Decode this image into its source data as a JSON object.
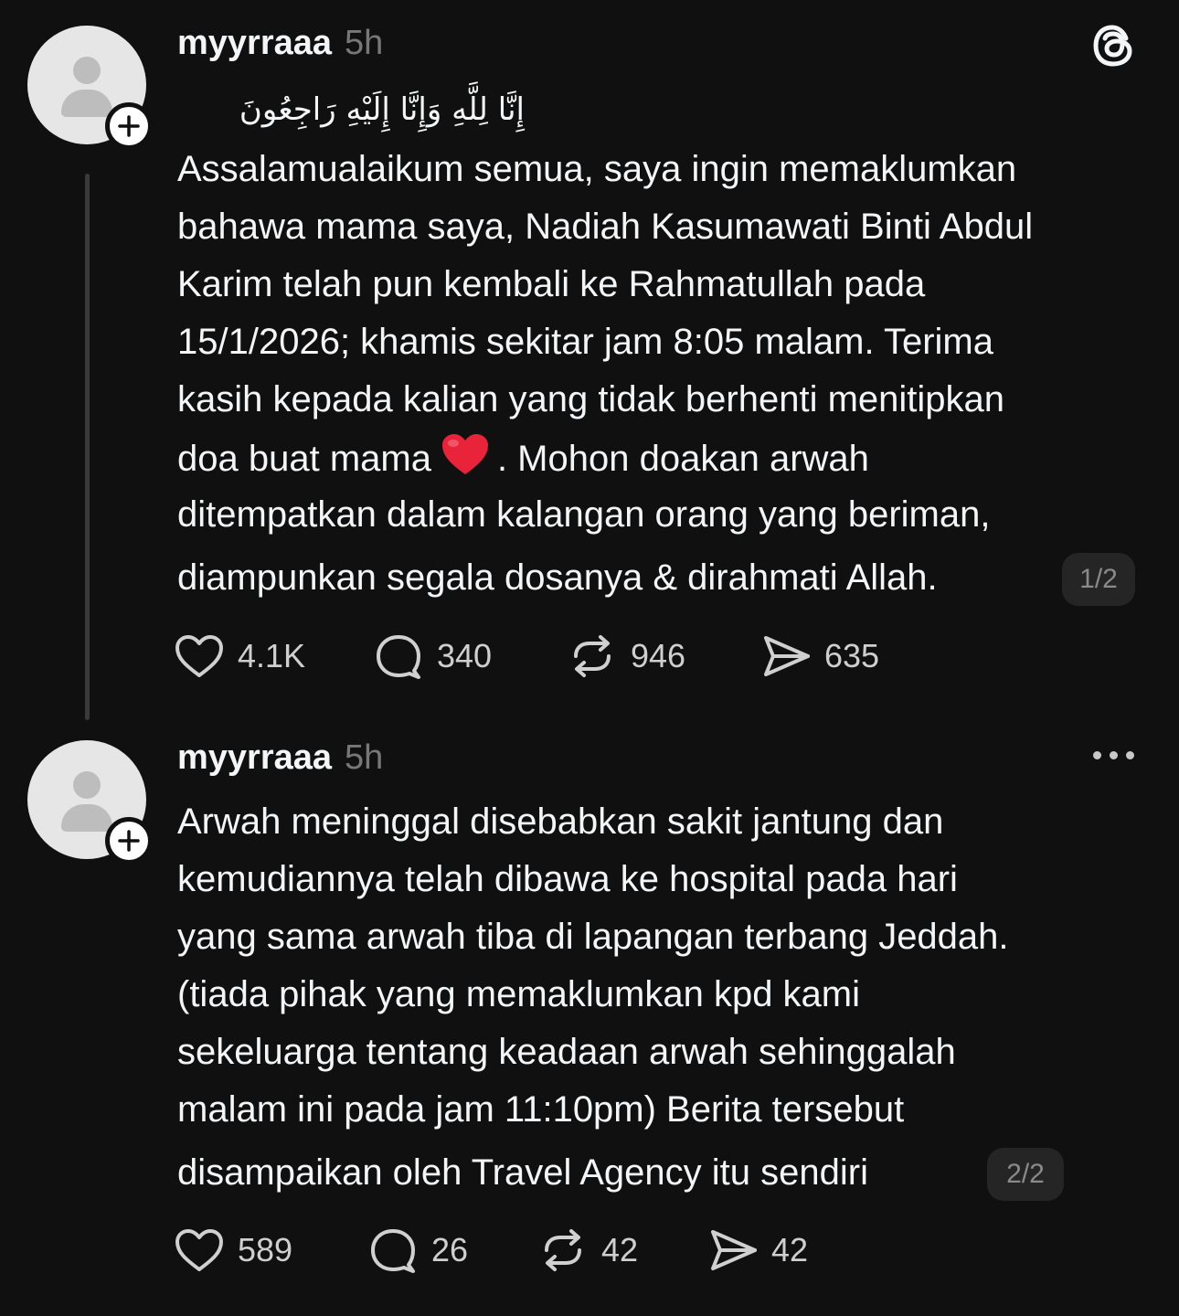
{
  "posts": [
    {
      "username": "myyrraaa",
      "time": "5h",
      "arabic_line": "إِنَّا لِلَّهِ وَإِنَّا إِلَيْهِ رَاجِعُونَ",
      "lines": [
        "Assalamualaikum semua, saya ingin memaklumkan",
        "bahawa mama saya, Nadiah Kasumawati Binti Abdul",
        "Karim telah pun kembali ke Rahmatullah pada",
        "15/1/2026; khamis sekitar jam 8:05 malam. Terima",
        "kasih kepada kalian yang tidak berhenti menitipkan"
      ],
      "line6_before_emoji": "doa buat mama",
      "line6_after_emoji": ". Mohon doakan arwah",
      "line7": "ditempatkan dalam kalangan orang yang beriman,",
      "line8": "diampunkan segala dosanya & dirahmati Allah.",
      "page_badge": "1/2",
      "likes": "4.1K",
      "replies": "340",
      "reposts": "946",
      "shares": "635",
      "corner_icon": "threads-logo-icon"
    },
    {
      "username": "myyrraaa",
      "time": "5h",
      "lines": [
        "Arwah meninggal disebabkan sakit jantung dan",
        "kemudiannya telah dibawa ke hospital pada hari",
        "yang sama arwah tiba di lapangan terbang Jeddah.",
        "(tiada pihak yang memaklumkan kpd kami",
        "sekeluarga tentang keadaan arwah sehinggalah",
        "malam ini pada jam 11:10pm) Berita tersebut"
      ],
      "last_line": "disampaikan oleh Travel Agency itu sendiri",
      "page_badge": "2/2",
      "likes": "589",
      "replies": "26",
      "reposts": "42",
      "shares": "42",
      "corner_icon": "more-options-icon"
    }
  ],
  "colors": {
    "background": "#101010",
    "text": "#f3f5f7",
    "muted": "#777777",
    "avatar_bg": "#e6e6e6",
    "heart_emoji": "#e8233a"
  }
}
